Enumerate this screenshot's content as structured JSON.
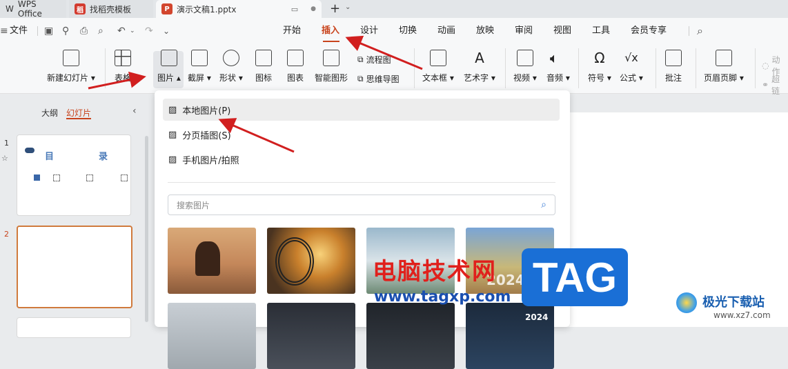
{
  "tabs": [
    {
      "label": "WPS Office"
    },
    {
      "label": "找稻壳模板"
    },
    {
      "label": "演示文稿1.pptx"
    }
  ],
  "menubar": {
    "file_label": "文件",
    "items": [
      "开始",
      "插入",
      "设计",
      "切换",
      "动画",
      "放映",
      "审阅",
      "视图",
      "工具",
      "会员专享"
    ],
    "active": "插入"
  },
  "ribbon": {
    "new_slide": "新建幻灯片",
    "table": "表格",
    "picture": "图片",
    "screenshot": "截屏",
    "shape": "形状",
    "icon": "图标",
    "chart": "图表",
    "smartart": "智能图形",
    "flowchart": "流程图",
    "mindmap": "思维导图",
    "textbox": "文本框",
    "wordart": "艺术字",
    "video": "视频",
    "audio": "音频",
    "symbol": "符号",
    "formula": "公式",
    "comment": "批注",
    "header_footer": "页眉页脚",
    "action": "动作",
    "hyperlink": "超链"
  },
  "leftpanel": {
    "outline_tab": "大纲",
    "slides_tab": "幻灯片",
    "slide1_number": "1",
    "slide2_number": "2",
    "slide1_title_a": "目",
    "slide1_title_b": "录"
  },
  "dropdown": {
    "items": [
      "本地图片(P)",
      "分页插图(S)",
      "手机图片/拍照"
    ],
    "search_placeholder": "搜索图片"
  },
  "thumbnail_overlay_text": "2024",
  "watermark": {
    "cn": "电脑技术网",
    "url": "www.tagxp.com",
    "tag": "TAG",
    "site_cn": "极光下载站",
    "site_url": "www.xz7.com"
  },
  "colors": {
    "accent": "#c8431c",
    "arrow": "#d11f1f",
    "tag_blue": "#1a6fd6",
    "watermark_red": "#e0201c"
  }
}
